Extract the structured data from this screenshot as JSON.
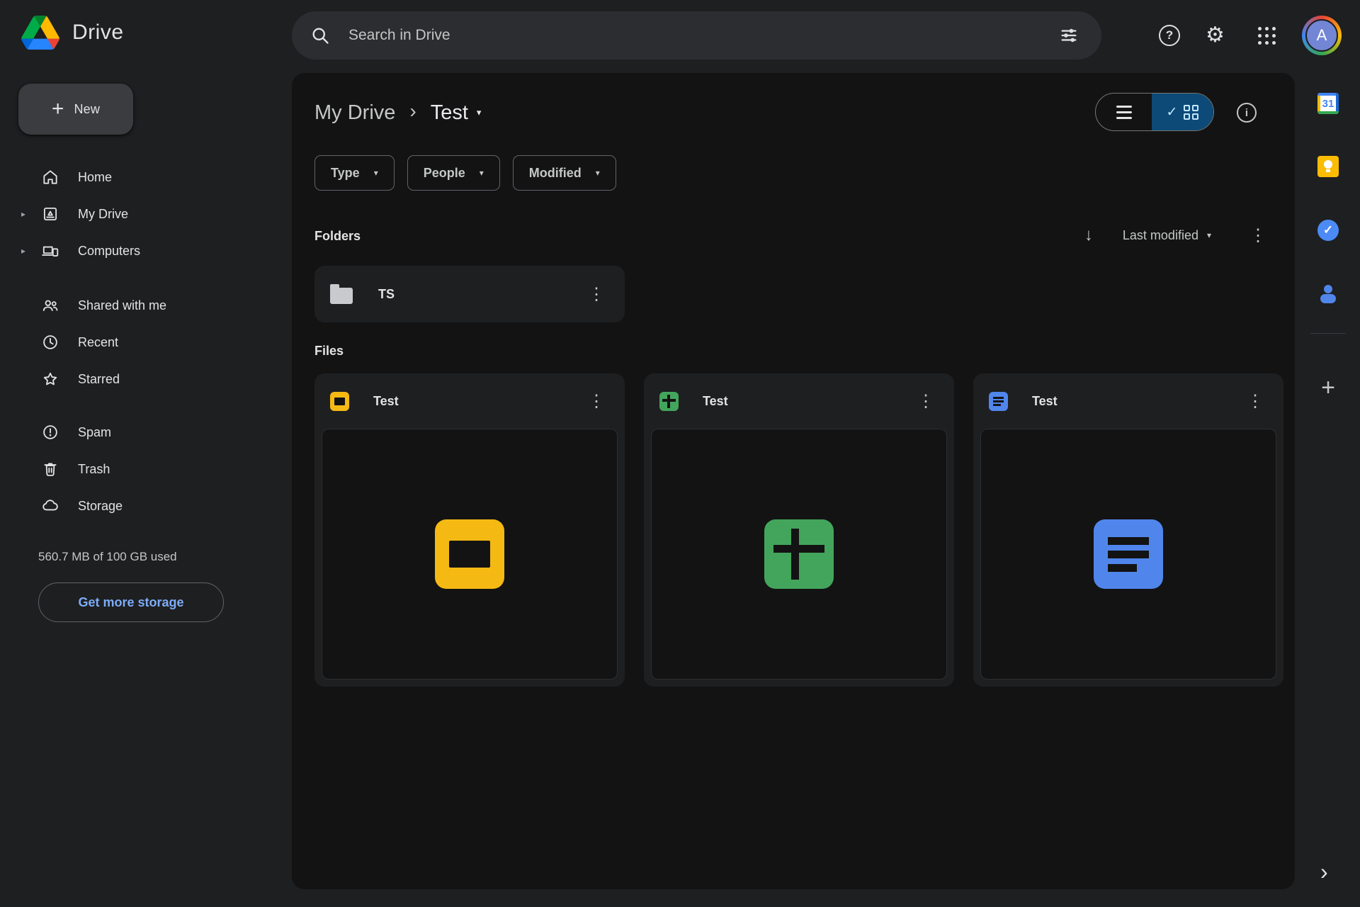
{
  "app": {
    "name": "Drive",
    "avatar_letter": "A"
  },
  "topbar": {
    "search_placeholder": "Search in Drive"
  },
  "sidebar": {
    "new_label": "New",
    "nav_primary": [
      {
        "label": "Home",
        "icon": "home-icon"
      },
      {
        "label": "My Drive",
        "icon": "my-drive-icon",
        "expandable": true
      },
      {
        "label": "Computers",
        "icon": "computers-icon",
        "expandable": true
      }
    ],
    "nav_secondary": [
      {
        "label": "Shared with me",
        "icon": "shared-icon"
      },
      {
        "label": "Recent",
        "icon": "recent-icon"
      },
      {
        "label": "Starred",
        "icon": "starred-icon"
      }
    ],
    "nav_tertiary": [
      {
        "label": "Spam",
        "icon": "spam-icon"
      },
      {
        "label": "Trash",
        "icon": "trash-icon"
      },
      {
        "label": "Storage",
        "icon": "storage-icon"
      }
    ],
    "storage_text": "560.7 MB of 100 GB used",
    "storage_button_label": "Get more storage"
  },
  "main": {
    "breadcrumb": {
      "parent": "My Drive",
      "current": "Test"
    },
    "filters": [
      {
        "label": "Type"
      },
      {
        "label": "People"
      },
      {
        "label": "Modified"
      }
    ],
    "folders_label": "Folders",
    "files_label": "Files",
    "sort_label": "Last modified",
    "folders": [
      {
        "name": "TS",
        "icon": "folder-icon"
      }
    ],
    "files": [
      {
        "name": "Test",
        "icon": "slides-file-icon"
      },
      {
        "name": "Test",
        "icon": "sheets-file-icon"
      },
      {
        "name": "Test",
        "icon": "docs-file-icon"
      }
    ]
  },
  "rail": {
    "calendar_day": "31"
  },
  "icons": {
    "kebab": "⋮",
    "caret_down": "▾",
    "expand_caret": "▸",
    "breadcrumb_chevron": "›",
    "sort_arrow": "↓",
    "plus": "+",
    "check": "✓",
    "question": "?",
    "gear": "⚙",
    "info": "i",
    "chevron_right": "›"
  },
  "colors": {
    "slides_yellow": "#F5B914",
    "sheets_green": "#43A55C",
    "docs_blue": "#5086EC",
    "link_blue": "#7CACF8",
    "toggle_selected_bg": "#0D4A77",
    "toggle_selected_fg": "#C2E7FF",
    "canvas_bg": "#131314",
    "surface_bg": "#1E1F20"
  }
}
